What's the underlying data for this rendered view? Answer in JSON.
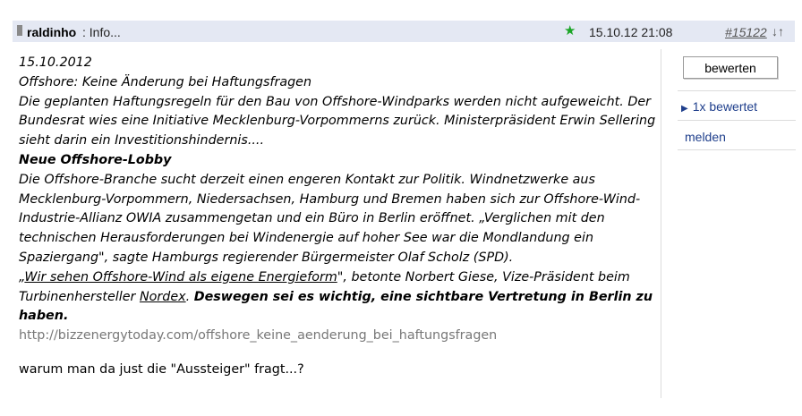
{
  "header": {
    "user": "raldinho",
    "subtitle": ": Info...",
    "datetime": "15.10.12 21:08",
    "post_number": "#15122",
    "sort_arrows": "↓↑",
    "star_color": "#1aa526"
  },
  "post": {
    "date": "15.10.2012",
    "headline": "Offshore: Keine Änderung bei Haftungsfragen",
    "para1": "Die geplanten Haftungsregeln für den Bau von Offshore-Windparks werden nicht aufgeweicht. Der Bundesrat wies eine Initiative Mecklenburg-Vorpommerns zurück. Ministerpräsident Erwin Sellering sieht darin ein Investitionshindernis....",
    "subheading": "Neue Offshore-Lobby",
    "para2": "Die Offshore-Branche sucht derzeit einen engeren Kontakt zur Politik. Windnetzwerke aus Mecklenburg-Vorpommern, Niedersachsen, Hamburg und Bremen haben sich zur Offshore-Wind-Industrie-Allianz OWIA zusammengetan und ein Büro in Berlin eröffnet. „Verglichen mit den technischen Herausforderungen bei Windenergie auf hoher See war die Mondlandung ein Spaziergang\", sagte Hamburgs regierender Bürgermeister Olaf Scholz (SPD).",
    "quote_open": "„",
    "quote_link": "Wir sehen Offshore-Wind als eigene Energieform",
    "quote_rest": "\", betonte Norbert Giese, Vize-Präsident beim Turbinenhersteller ",
    "company_link": "Nordex",
    "period": ". ",
    "bold_ending": "Deswegen sei es wichtig, eine sichtbare Vertretung in Berlin zu haben",
    "bold_period": ".",
    "source_url": "http://bizzenergytoday.com/offshore_keine_aenderung_bei_haftungsfragen",
    "comment": "warum man da just die \"Aussteiger\" fragt...?"
  },
  "sidebar": {
    "rate_button": "bewerten",
    "rated_count": "1x bewertet",
    "report": "melden"
  }
}
